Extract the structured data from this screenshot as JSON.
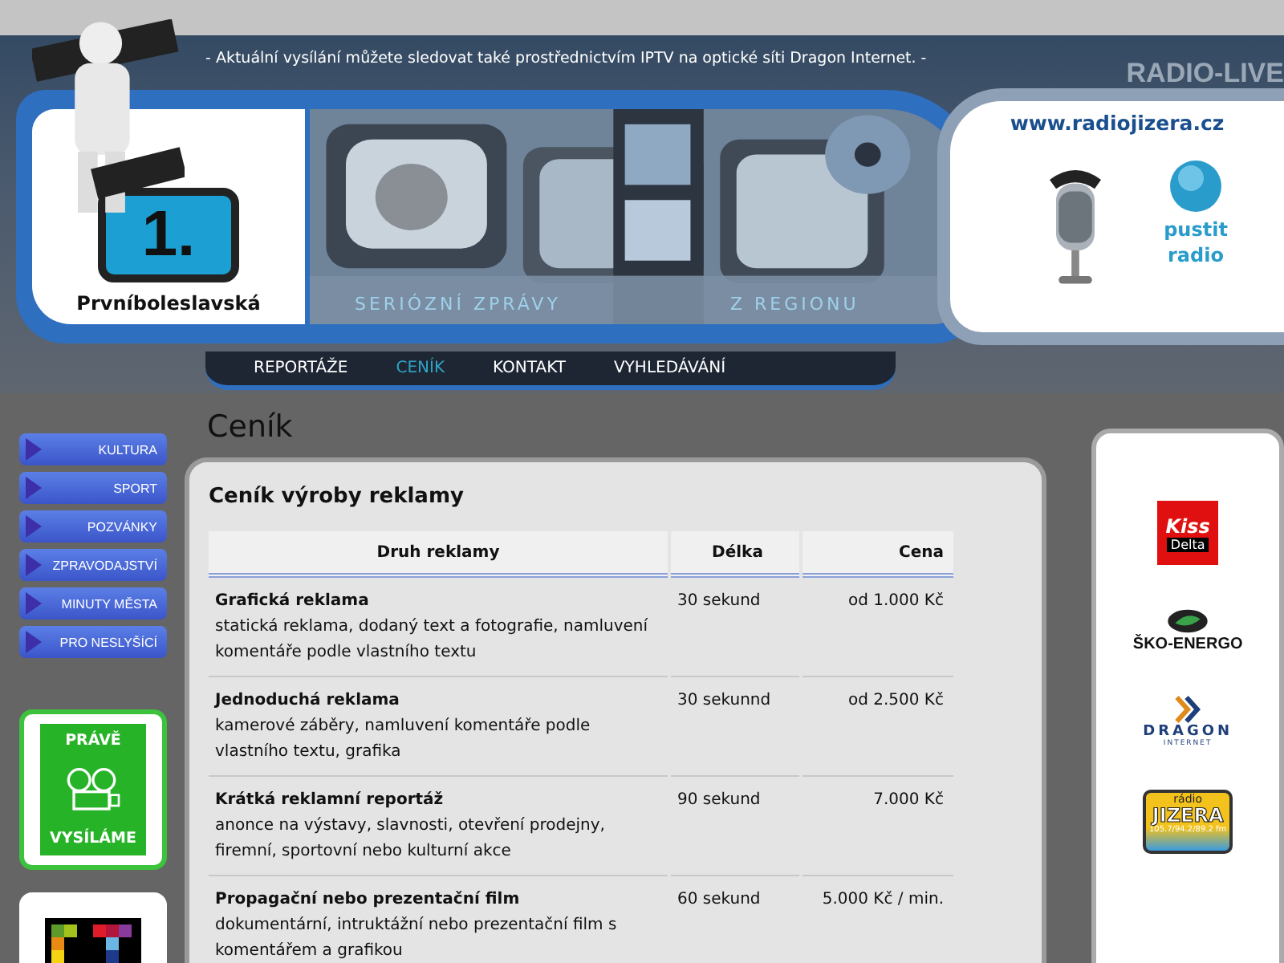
{
  "announcement": "- Aktuální vysílání můžete sledovat také prostřednictvím IPTV na optické síti Dragon Internet. -",
  "logo": {
    "number": "1.",
    "name": "Prvníboleslavská"
  },
  "banner": {
    "kind": "picture",
    "slogan_left": "SERIÓZNÍ ZPRÁVY",
    "slogan_right": "Z REGIONU"
  },
  "radio": {
    "heading": "RADIO-LIVE",
    "url": "www.radiojizera.cz",
    "play_label": "pustit radio"
  },
  "nav": [
    {
      "label": "REPORTÁŽE",
      "selected": false
    },
    {
      "label": "CENÍK",
      "selected": true
    },
    {
      "label": "KONTAKT",
      "selected": false
    },
    {
      "label": "VYHLEDÁVÁNÍ",
      "selected": false
    }
  ],
  "sidebar": {
    "items": [
      "KULTURA",
      "SPORT",
      "POZVÁNKY",
      "ZPRAVODAJSTVÍ",
      "MINUTY MĚSTA",
      "PRO NESLYŠÍCÍ"
    ],
    "live_banner": {
      "top": "PRÁVĚ",
      "bottom": "VYSÍLÁME"
    }
  },
  "page_title": "Ceník",
  "content": {
    "title": "Ceník výroby reklamy",
    "table": {
      "columns": [
        "Druh reklamy",
        "Délka",
        "Cena"
      ],
      "rows": [
        {
          "name": "Grafická reklama",
          "description": "statická reklama, dodaný text a fotografie, namluvení komentáře podle vlastního textu",
          "length": "30 sekund",
          "price": "od 1.000 Kč"
        },
        {
          "name": "Jednoduchá reklama",
          "description": "kamerové záběry, namluvení komentáře podle vlastního textu, grafika",
          "length": "30 sekunnd",
          "price": "od 2.500 Kč"
        },
        {
          "name": "Krátká reklamní reportáž",
          "description": "anonce na výstavy, slavnosti, otevření prodejny, firemní, sportovní nebo kulturní akce",
          "length": "90 sekund",
          "price": "7.000 Kč"
        },
        {
          "name": "Propagační nebo prezentační film",
          "description": "dokumentární, intruktážní nebo prezentační film s komentářem a grafikou",
          "length": "60 sekund",
          "price": "5.000 Kč / min."
        }
      ]
    }
  },
  "sponsors": [
    {
      "kind": "kiss",
      "texts": [
        "Kiss",
        "Delta"
      ]
    },
    {
      "kind": "skoenergo",
      "texts": [
        "ŠKO-ENERGO"
      ]
    },
    {
      "kind": "dragon",
      "texts": [
        "DRAGON",
        "INTERNET"
      ]
    },
    {
      "kind": "jizera",
      "texts": [
        "rádio",
        "JIZERA",
        "105.7/94.2/89.2 fm"
      ]
    }
  ]
}
